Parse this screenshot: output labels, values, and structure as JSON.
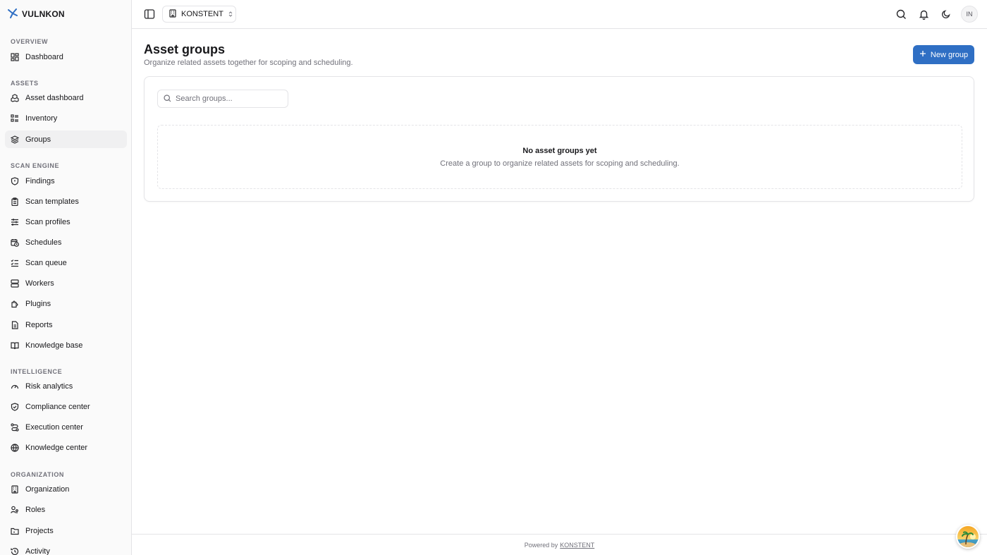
{
  "brand": {
    "name": "VULNKON",
    "accent": "#2f6fc4"
  },
  "sidebar": {
    "sections": [
      {
        "label": "OVERVIEW",
        "items": [
          {
            "label": "Dashboard",
            "icon": "dashboard-icon"
          }
        ]
      },
      {
        "label": "ASSETS",
        "items": [
          {
            "label": "Asset dashboard",
            "icon": "boxes-icon"
          },
          {
            "label": "Inventory",
            "icon": "list-icon"
          },
          {
            "label": "Groups",
            "icon": "layers-icon",
            "active": true
          }
        ]
      },
      {
        "label": "SCAN ENGINE",
        "items": [
          {
            "label": "Findings",
            "icon": "shield-icon"
          },
          {
            "label": "Scan templates",
            "icon": "clipboard-icon"
          },
          {
            "label": "Scan profiles",
            "icon": "sliders-icon"
          },
          {
            "label": "Schedules",
            "icon": "calendar-clock-icon"
          },
          {
            "label": "Scan queue",
            "icon": "list-checks-icon"
          },
          {
            "label": "Workers",
            "icon": "server-icon"
          },
          {
            "label": "Plugins",
            "icon": "puzzle-icon"
          },
          {
            "label": "Reports",
            "icon": "file-icon"
          },
          {
            "label": "Knowledge base",
            "icon": "book-icon"
          }
        ]
      },
      {
        "label": "INTELLIGENCE",
        "items": [
          {
            "label": "Risk analytics",
            "icon": "gauge-icon"
          },
          {
            "label": "Compliance center",
            "icon": "shield-check-icon"
          },
          {
            "label": "Execution center",
            "icon": "route-icon"
          },
          {
            "label": "Knowledge center",
            "icon": "globe-icon"
          }
        ]
      },
      {
        "label": "ORGANIZATION",
        "items": [
          {
            "label": "Organization",
            "icon": "building-icon"
          },
          {
            "label": "Roles",
            "icon": "user-key-icon"
          },
          {
            "label": "Projects",
            "icon": "folder-icon"
          },
          {
            "label": "Activity",
            "icon": "history-icon"
          }
        ]
      }
    ]
  },
  "topbar": {
    "org_name": "KONSTENT",
    "avatar_initials": "IN"
  },
  "page": {
    "title": "Asset groups",
    "subtitle": "Organize related assets together for scoping and scheduling.",
    "new_button_label": "New group"
  },
  "search": {
    "placeholder": "Search groups..."
  },
  "empty_state": {
    "title": "No asset groups yet",
    "description": "Create a group to organize related assets for scoping and scheduling."
  },
  "footer": {
    "prefix": "Powered by",
    "link": "KONSTENT"
  }
}
